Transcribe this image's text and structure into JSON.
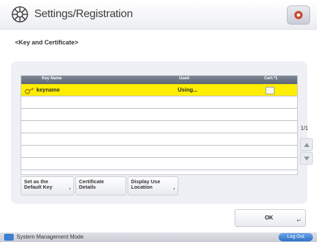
{
  "header": {
    "title": "Settings/Registration"
  },
  "breadcrumb": "<Key and Certificate>",
  "table": {
    "columns": [
      "Key Name",
      "Used",
      "Cert.*1"
    ],
    "rows": [
      {
        "key_name": "keyname",
        "used": "Using...",
        "selected": true
      }
    ]
  },
  "pager": "1/1",
  "actions": {
    "set_default": [
      "Set as the",
      "Default Key"
    ],
    "cert_details": [
      "Certificate",
      "Details"
    ],
    "display_use": [
      "Display Use",
      "Location"
    ]
  },
  "ok_label": "OK",
  "footer": {
    "mode_label": "System Management Mode",
    "logout_label": "Log Out"
  },
  "colors": {
    "selected_row": "#ffee00",
    "accent_blue": "#2f6fc4"
  }
}
